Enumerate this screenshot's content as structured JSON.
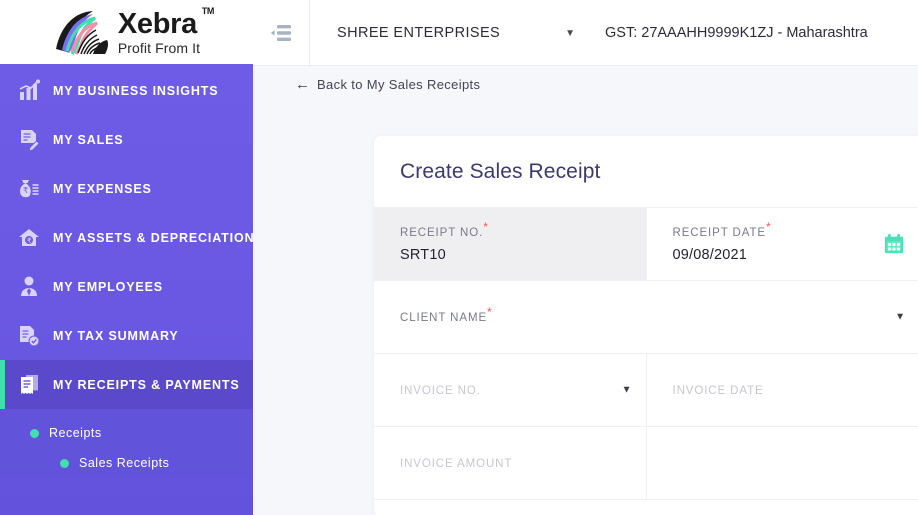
{
  "brand": {
    "name": "Xebra",
    "tm": "TM",
    "tagline": "Profit From It",
    "logo_icon": "zebra-head-icon",
    "accent_teal": "#3fdfae",
    "accent_purple": "#6f5ce6"
  },
  "topbar": {
    "collapse_icon": "collapse-menu-icon",
    "company": "SHREE ENTERPRISES",
    "company_caret": "▼",
    "gst": "GST: 27AAAHH9999K1ZJ - Maharashtra"
  },
  "sidebar": {
    "items": [
      {
        "label": "MY BUSINESS INSIGHTS",
        "icon": "bar-chart-icon",
        "active": false
      },
      {
        "label": "MY SALES",
        "icon": "invoice-edit-icon",
        "active": false
      },
      {
        "label": "MY EXPENSES",
        "icon": "money-bag-icon",
        "active": false
      },
      {
        "label": "MY ASSETS & DEPRECIATION",
        "icon": "home-rupee-icon",
        "active": false
      },
      {
        "label": "MY EMPLOYEES",
        "icon": "user-tie-icon",
        "active": false
      },
      {
        "label": "MY TAX SUMMARY",
        "icon": "tax-document-icon",
        "active": false
      },
      {
        "label": "MY RECEIPTS & PAYMENTS",
        "icon": "receipt-stack-icon",
        "active": true
      }
    ],
    "submenu": [
      {
        "label": "Receipts",
        "level": 1
      },
      {
        "label": "Sales Receipts",
        "level": 2
      }
    ]
  },
  "content": {
    "back_link": "Back to My Sales Receipts",
    "back_arrow": "←"
  },
  "card": {
    "title": "Create Sales Receipt",
    "fields": {
      "receipt_no": {
        "label": "RECEIPT NO.",
        "required": true,
        "value": "SRT10"
      },
      "receipt_date": {
        "label": "RECEIPT DATE",
        "required": true,
        "value": "09/08/2021",
        "icon": "calendar-icon"
      },
      "client_name": {
        "label": "CLIENT NAME",
        "required": true,
        "value": "",
        "caret": "▼"
      },
      "invoice_no": {
        "label": "INVOICE NO.",
        "required": false,
        "value": "",
        "caret": "▼"
      },
      "invoice_date": {
        "label": "INVOICE DATE",
        "required": false,
        "value": ""
      },
      "invoice_amount": {
        "label": "INVOICE AMOUNT",
        "required": false,
        "value": ""
      }
    }
  }
}
